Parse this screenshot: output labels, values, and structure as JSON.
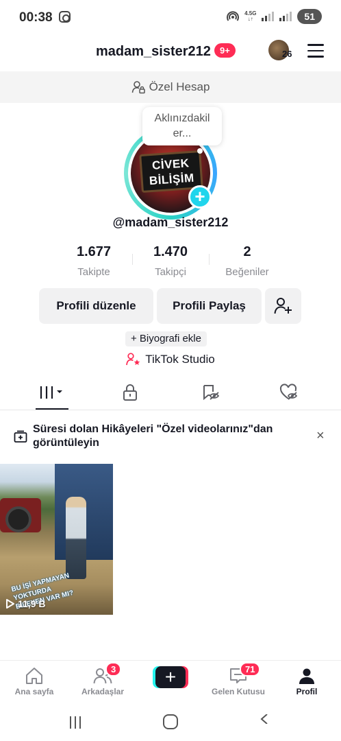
{
  "status_bar": {
    "time": "00:38",
    "network_label": "4.5G",
    "battery": "51"
  },
  "header": {
    "username": "madam_sister212",
    "notification_badge": "9+",
    "avatar_count": "26"
  },
  "private_account": {
    "label": "Özel Hesap"
  },
  "profile": {
    "thought_bubble_line1": "Aklınızdakil",
    "thought_bubble_line2": "er...",
    "avatar_text_line1": "CİVEK",
    "avatar_text_line2": "BİLİŞİM",
    "handle": "@madam_sister212"
  },
  "stats": [
    {
      "value": "1.677",
      "label": "Takipte"
    },
    {
      "value": "1.470",
      "label": "Takipçi"
    },
    {
      "value": "2",
      "label": "Beğeniler"
    }
  ],
  "actions": {
    "edit_profile": "Profili düzenle",
    "share_profile": "Profili Paylaş",
    "add_bio": "+ Biyografi ekle",
    "studio": "TikTok Studio"
  },
  "tabs": [
    {
      "name": "videos-tab",
      "icon": "grid-icon",
      "active": true
    },
    {
      "name": "private-tab",
      "icon": "lock-icon",
      "active": false
    },
    {
      "name": "reposts-tab",
      "icon": "repost-hidden-icon",
      "active": false
    },
    {
      "name": "liked-tab",
      "icon": "heart-hidden-icon",
      "active": false
    }
  ],
  "banner": {
    "text": "Süresi dolan Hikâyeleri \"Özel videolarınız\"dan görüntüleyin",
    "close": "×"
  },
  "videos": [
    {
      "caption_line1": "BU İŞİ YAPMAYAN YOKTURDA",
      "caption_line2": "BİLEYEN VAR MI?",
      "views": "11,9 B"
    }
  ],
  "bottom_nav": {
    "home": {
      "label": "Ana sayfa"
    },
    "friends": {
      "label": "Arkadaşlar",
      "badge": "3"
    },
    "create": {
      "label": "+"
    },
    "inbox": {
      "label": "Gelen Kutusu",
      "badge": "71"
    },
    "profile": {
      "label": "Profil"
    }
  },
  "colors": {
    "accent": "#fe2c55",
    "cyan": "#25f4ee",
    "text": "#161823",
    "secondary_text": "#8a8b91"
  }
}
